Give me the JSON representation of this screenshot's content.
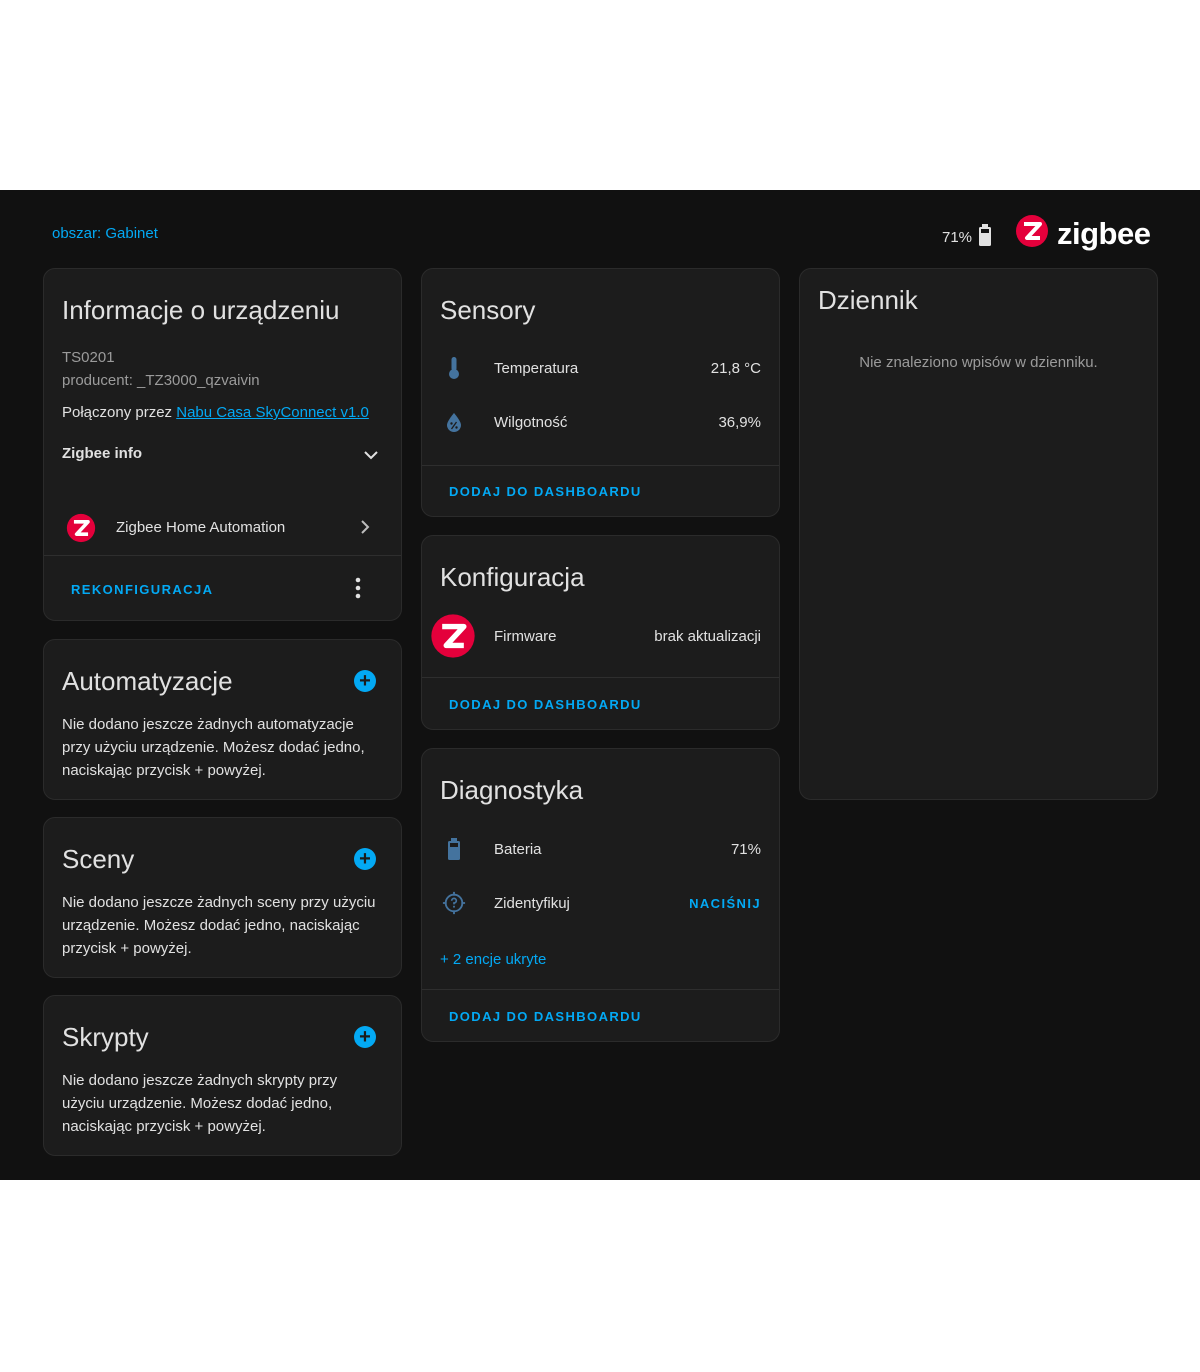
{
  "header": {
    "area_link": "obszar: Gabinet",
    "battery_percent": "71%",
    "brand_wordmark": "zigbee"
  },
  "device_info": {
    "title": "Informacje o urządzeniu",
    "model": "TS0201",
    "manufacturer": "producent: _TZ3000_qzvaivin",
    "connected_prefix": "Połączony przez ",
    "connected_link": "Nabu Casa SkyConnect v1.0",
    "zigbee_info_label": "Zigbee info",
    "integration_label": "Zigbee Home Automation",
    "reconfigure_label": "REKONFIGURACJA"
  },
  "automations": {
    "title": "Automatyzacje",
    "description": "Nie dodano jeszcze żadnych automatyzacje przy użyciu urządzenie. Możesz dodać jedno, naciskając przycisk + powyżej."
  },
  "scenes": {
    "title": "Sceny",
    "description": "Nie dodano jeszcze żadnych sceny przy użyciu urządzenie. Możesz dodać jedno, naciskając przycisk + powyżej."
  },
  "scripts": {
    "title": "Skrypty",
    "description": "Nie dodano jeszcze żadnych skrypty przy użyciu urządzenie. Możesz dodać jedno, naciskając przycisk + powyżej."
  },
  "sensors": {
    "title": "Sensory",
    "rows": [
      {
        "label": "Temperatura",
        "value": "21,8 °C",
        "icon": "thermometer-icon"
      },
      {
        "label": "Wilgotność",
        "value": "36,9%",
        "icon": "water-percent-icon"
      }
    ],
    "action": "DODAJ DO DASHBOARDU"
  },
  "configuration": {
    "title": "Konfiguracja",
    "rows": [
      {
        "label": "Firmware",
        "value": "brak aktualizacji",
        "icon": "zigbee-logo-icon"
      }
    ],
    "action": "DODAJ DO DASHBOARDU"
  },
  "diagnostics": {
    "title": "Diagnostyka",
    "rows": [
      {
        "label": "Bateria",
        "value": "71%",
        "icon": "battery-icon"
      },
      {
        "label": "Zidentyfikuj",
        "value": "NACIŚNIJ",
        "icon": "crosshairs-question-icon"
      }
    ],
    "hidden_entities": "+ 2 encje ukryte",
    "action": "DODAJ DO DASHBOARDU"
  },
  "logbook": {
    "title": "Dziennik",
    "empty_message": "Nie znaleziono wpisów w dzienniku."
  },
  "colors": {
    "accent": "#03a9f4",
    "background": "#111111",
    "card": "#1c1c1c",
    "zigbee_red": "#e4003b"
  }
}
